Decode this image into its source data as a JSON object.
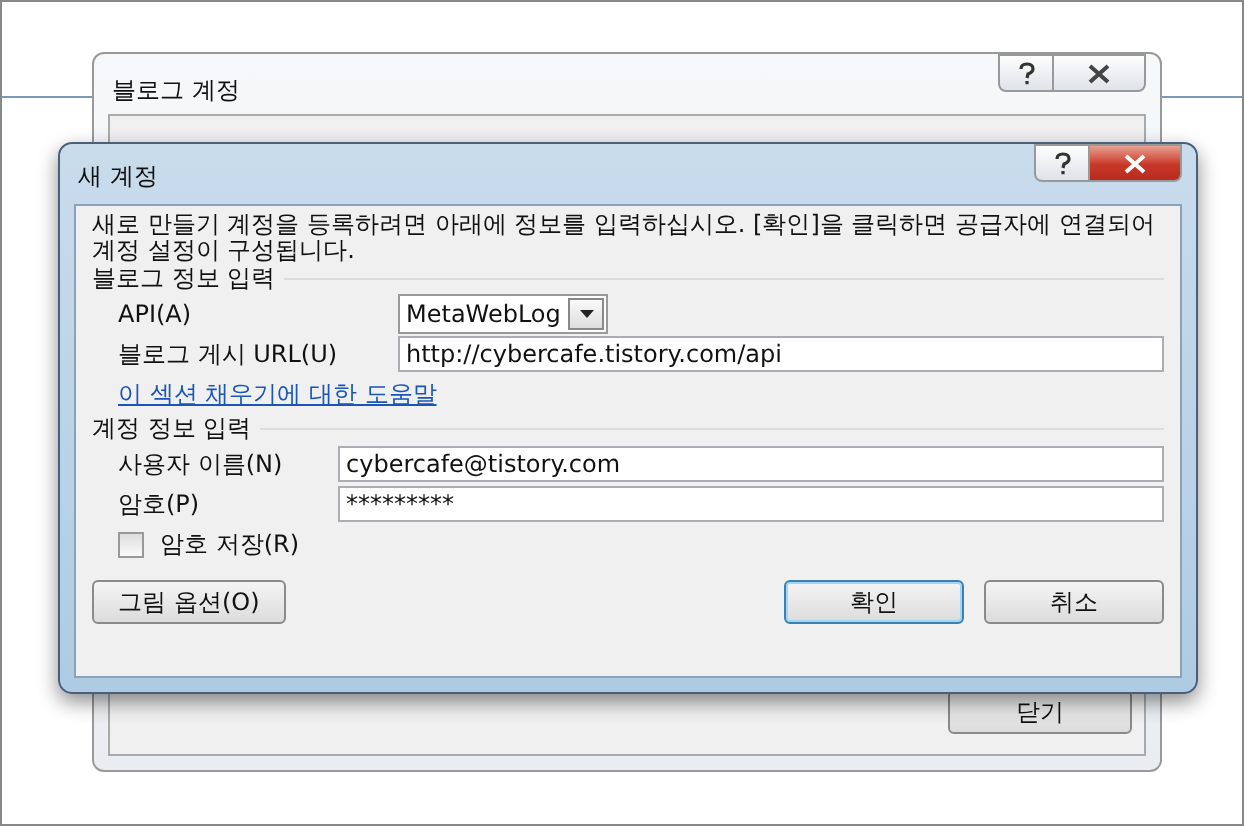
{
  "back_window": {
    "title": "블로그 계정",
    "close_button": "닫기"
  },
  "dialog": {
    "title": "새 계정",
    "intro": "새로 만들기 계정을 등록하려면 아래에 정보를 입력하십시오. [확인]을 클릭하면 공급자에 연결되어 계정 설정이 구성됩니다.",
    "blog_section": {
      "heading": "블로그 정보 입력",
      "api_label": "API(A)",
      "api_value": "MetaWebLog",
      "url_label": "블로그 게시 URL(U)",
      "url_value": "http://cybercafe.tistory.com/api",
      "help_link": "이 섹션 채우기에 대한 도움말"
    },
    "account_section": {
      "heading": "계정 정보 입력",
      "user_label": "사용자 이름(N)",
      "user_value": "cybercafe@tistory.com",
      "password_label": "암호(P)",
      "password_value": "*********",
      "remember": {
        "label": "암호 저장(R)",
        "checked": false
      }
    },
    "buttons": [
      {
        "label": "그림 옵션(O)",
        "kind": "left",
        "default": false
      },
      {
        "label": "확인",
        "kind": "right",
        "default": true
      },
      {
        "label": "취소",
        "kind": "right",
        "default": false
      }
    ]
  }
}
